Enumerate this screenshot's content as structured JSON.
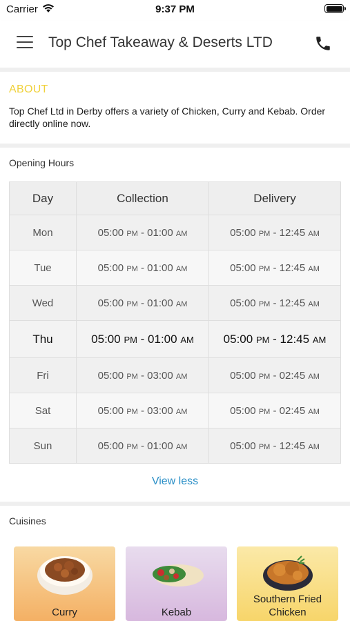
{
  "status_bar": {
    "carrier": "Carrier",
    "time": "9:37 PM"
  },
  "nav": {
    "title": "Top Chef Takeaway & Deserts LTD",
    "menu_icon": "hamburger-menu-icon",
    "phone_icon": "phone-icon"
  },
  "about": {
    "title": "ABOUT",
    "text": "Top Chef Ltd in Derby offers a variety of Chicken, Curry and  Kebab. Order directly online now."
  },
  "opening_hours": {
    "title": "Opening Hours",
    "headers": {
      "day": "Day",
      "collection": "Collection",
      "delivery": "Delivery"
    },
    "rows": [
      {
        "day": "Mon",
        "c_start": "05:00",
        "c_start_ampm": "PM",
        "c_end": "01:00",
        "c_end_ampm": "AM",
        "d_start": "05:00",
        "d_start_ampm": "PM",
        "d_end": "12:45",
        "d_end_ampm": "AM"
      },
      {
        "day": "Tue",
        "c_start": "05:00",
        "c_start_ampm": "PM",
        "c_end": "01:00",
        "c_end_ampm": "AM",
        "d_start": "05:00",
        "d_start_ampm": "PM",
        "d_end": "12:45",
        "d_end_ampm": "AM"
      },
      {
        "day": "Wed",
        "c_start": "05:00",
        "c_start_ampm": "PM",
        "c_end": "01:00",
        "c_end_ampm": "AM",
        "d_start": "05:00",
        "d_start_ampm": "PM",
        "d_end": "12:45",
        "d_end_ampm": "AM"
      },
      {
        "day": "Thu",
        "c_start": "05:00",
        "c_start_ampm": "PM",
        "c_end": "01:00",
        "c_end_ampm": "AM",
        "d_start": "05:00",
        "d_start_ampm": "PM",
        "d_end": "12:45",
        "d_end_ampm": "AM"
      },
      {
        "day": "Fri",
        "c_start": "05:00",
        "c_start_ampm": "PM",
        "c_end": "03:00",
        "c_end_ampm": "AM",
        "d_start": "05:00",
        "d_start_ampm": "PM",
        "d_end": "02:45",
        "d_end_ampm": "AM"
      },
      {
        "day": "Sat",
        "c_start": "05:00",
        "c_start_ampm": "PM",
        "c_end": "03:00",
        "c_end_ampm": "AM",
        "d_start": "05:00",
        "d_start_ampm": "PM",
        "d_end": "02:45",
        "d_end_ampm": "AM"
      },
      {
        "day": "Sun",
        "c_start": "05:00",
        "c_start_ampm": "PM",
        "c_end": "01:00",
        "c_end_ampm": "AM",
        "d_start": "05:00",
        "d_start_ampm": "PM",
        "d_end": "12:45",
        "d_end_ampm": "AM"
      }
    ],
    "view_less": "View less"
  },
  "cuisines": {
    "title": "Cuisines",
    "items": [
      {
        "label": "Curry"
      },
      {
        "label": "Kebab"
      },
      {
        "label": "Southern Fried Chicken"
      }
    ]
  },
  "colors": {
    "accent": "#f0d13a",
    "link": "#2a8fc7"
  }
}
